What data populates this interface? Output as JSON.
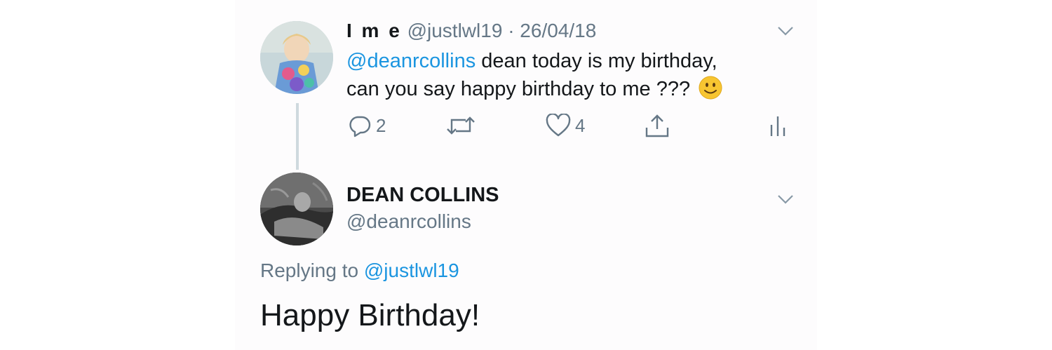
{
  "tweet1": {
    "display_name": "I m e",
    "handle": "@justlwl19",
    "separator": "·",
    "date": "26/04/18",
    "mention": "@deanrcollins",
    "text_line1": " dean today is my birthday,",
    "text_line2": "can you say happy birthday to me ???",
    "emoji": "slightly-smiling-face",
    "reply_count": "2",
    "like_count": "4"
  },
  "tweet2": {
    "display_name": "DEAN COLLINS",
    "handle": "@deanrcollins",
    "replying_prefix": "Replying to ",
    "replying_to": "@justlwl19",
    "text": "Happy Birthday!"
  },
  "colors": {
    "accent": "#1b95e0",
    "secondary": "#657786",
    "primary_text": "#14171a"
  }
}
